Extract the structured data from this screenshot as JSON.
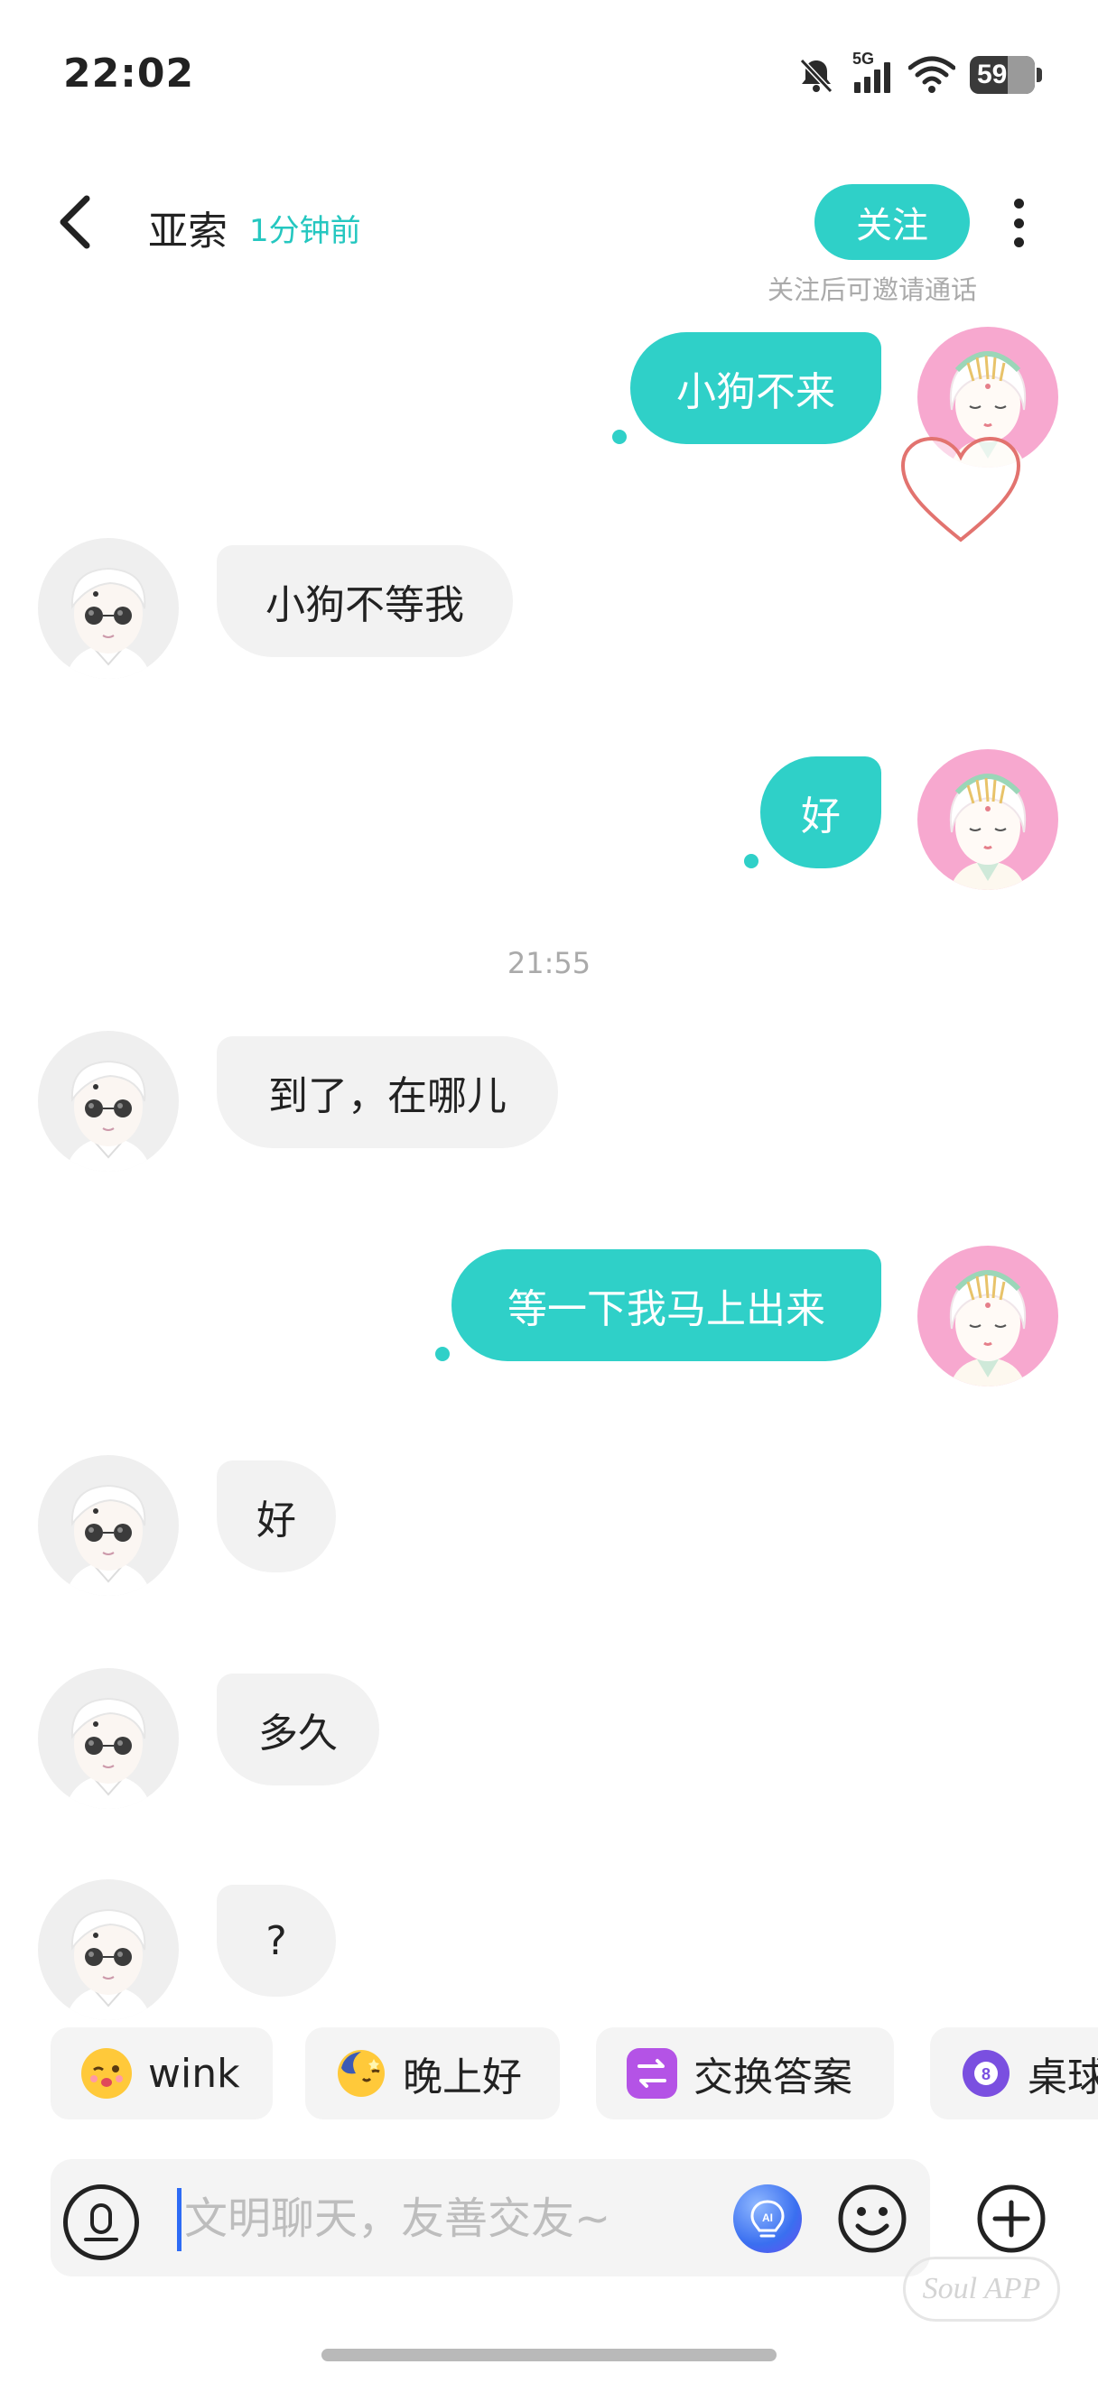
{
  "status_bar": {
    "time": "22:02",
    "network_label": "5G",
    "battery_percent": 59,
    "battery_label": "59"
  },
  "header": {
    "contact_name": "亚索",
    "last_seen": "1分钟前",
    "follow_label": "关注",
    "follow_hint": "关注后可邀请通话"
  },
  "messages": [
    {
      "from": "me",
      "text": "小狗不来",
      "read": true
    },
    {
      "from": "them",
      "text": "小狗不等我"
    },
    {
      "from": "me",
      "text": "好",
      "read": true
    },
    {
      "type": "timestamp",
      "text": "21:55"
    },
    {
      "from": "them",
      "text": "到了，在哪儿"
    },
    {
      "from": "me",
      "text": "等一下我马上出来",
      "read": true
    },
    {
      "from": "them",
      "text": "好"
    },
    {
      "from": "them",
      "text": "多久"
    },
    {
      "from": "them",
      "text": "?"
    }
  ],
  "quick_replies": [
    {
      "label": "wink",
      "icon": "wink-emoji-icon"
    },
    {
      "label": "晚上好",
      "icon": "moon-emoji-icon"
    },
    {
      "label": "交换答案",
      "icon": "swap-icon"
    },
    {
      "label": "桌球",
      "icon": "billiard-ball-icon"
    }
  ],
  "input": {
    "placeholder": "文明聊天，友善交友~"
  },
  "watermark": "Soul APP",
  "colors": {
    "accent": "#2fd0c8",
    "incoming_bubble": "#f2f2f2",
    "my_avatar_bg": "#f7a8cf",
    "their_avatar_bg": "#efefef"
  }
}
